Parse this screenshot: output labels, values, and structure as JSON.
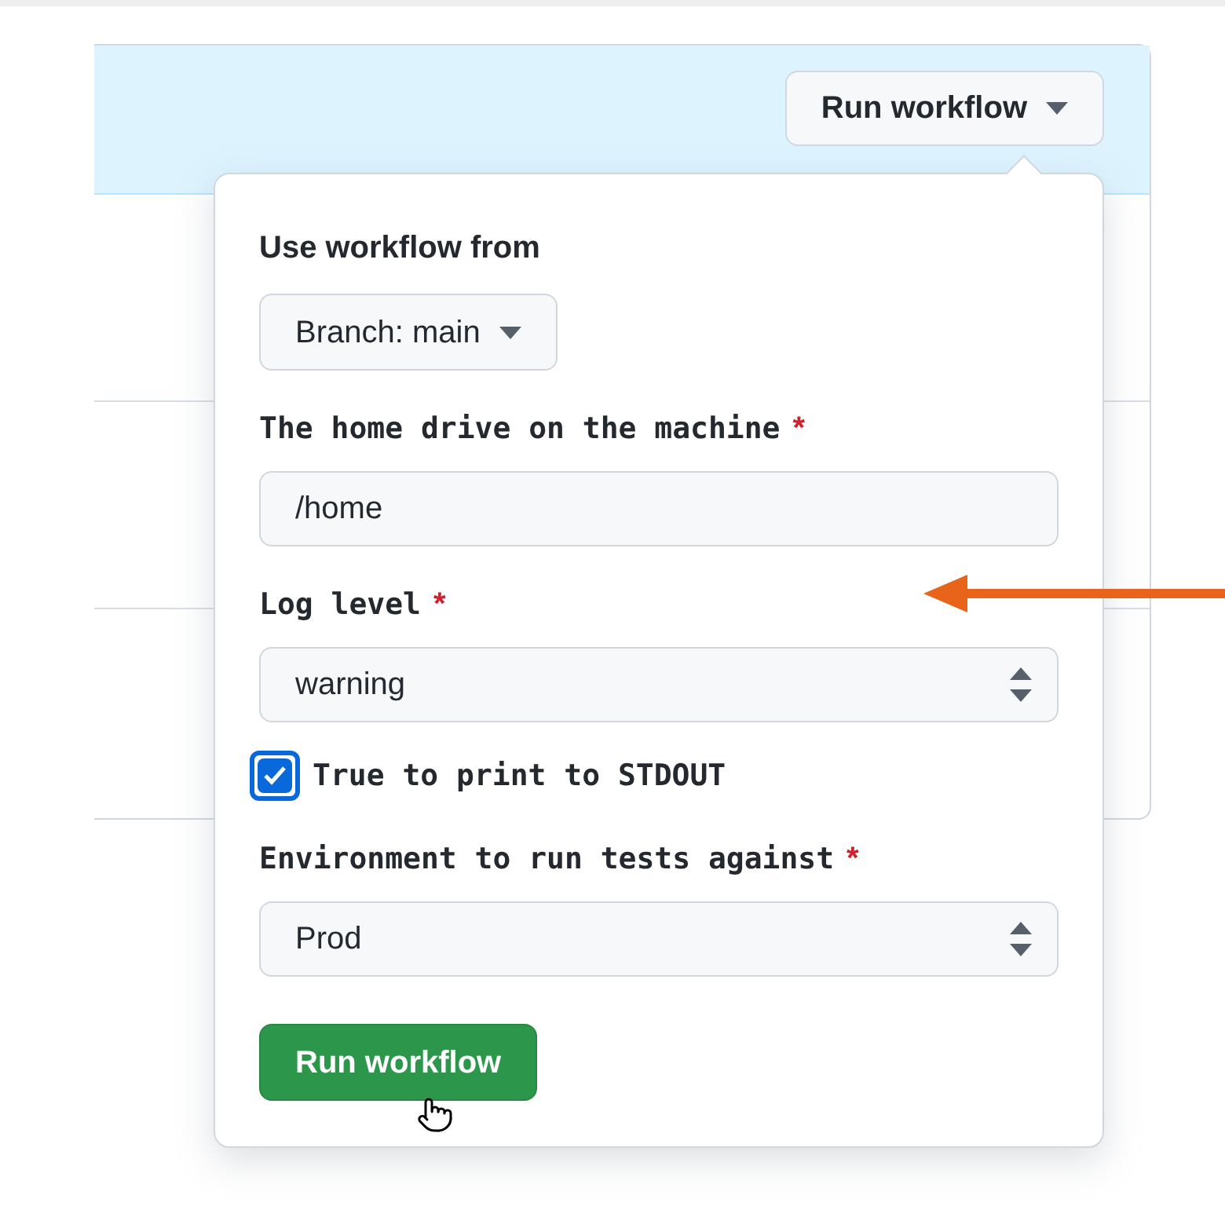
{
  "header": {
    "run_button": {
      "label": "Run workflow"
    }
  },
  "popover": {
    "title": "Use workflow from",
    "branch_button": {
      "label": "Branch: main"
    },
    "fields": [
      {
        "kind": "text",
        "label": "The home drive on the machine",
        "required": true,
        "value": "/home"
      },
      {
        "kind": "select",
        "label": "Log level",
        "required": true,
        "value": "warning"
      },
      {
        "kind": "checkbox",
        "label": "True to print to STDOUT",
        "checked": true
      },
      {
        "kind": "select",
        "label": "Environment to run tests against",
        "required": true,
        "value": "Prod"
      }
    ],
    "submit_button": {
      "label": "Run workflow"
    },
    "required_mark": "*"
  }
}
